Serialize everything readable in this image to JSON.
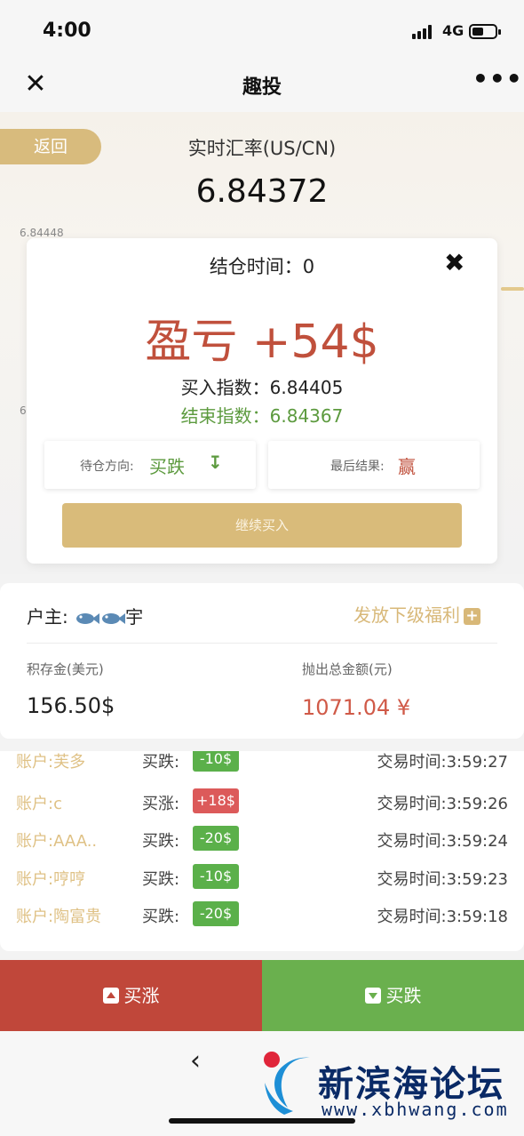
{
  "status": {
    "time": "4:00",
    "network": "4G"
  },
  "nav": {
    "title": "趣投"
  },
  "hero": {
    "back_label": "返回",
    "rate_label": "实时汇率(US/CN)",
    "rate_value": "6.84372",
    "axis_top": "6.84448",
    "axis_mid": "6"
  },
  "modal": {
    "title": "结仓时间：0",
    "pnl": "盈亏 +54$",
    "buy_index": "买入指数：6.84405",
    "end_index": "结束指数：6.84367",
    "direction_label": "待仓方向:",
    "direction_value": "买跌",
    "result_label": "最后结果:",
    "result_value": "赢",
    "continue_label": "继续买入"
  },
  "account": {
    "owner_label": "户主:",
    "owner_name": "宇",
    "welfare_label": "发放下级福利",
    "deposit_label": "积存金(美元)",
    "deposit_value": "156.50$",
    "withdraw_label": "抛出总金额(元)",
    "withdraw_value": "1071.04 ¥"
  },
  "trades": [
    {
      "account": "账户:芙多",
      "type": "买跌:",
      "amount": "-10$",
      "time": "交易时间:3:59:27",
      "color": "#5bb04a"
    },
    {
      "account": "账户:c",
      "type": "买涨:",
      "amount": "+18$",
      "time": "交易时间:3:59:26",
      "color": "#dc5a5a"
    },
    {
      "account": "账户:AAA..",
      "type": "买跌:",
      "amount": "-20$",
      "time": "交易时间:3:59:24",
      "color": "#5bb04a"
    },
    {
      "account": "账户:哼哼",
      "type": "买跌:",
      "amount": "-10$",
      "time": "交易时间:3:59:23",
      "color": "#5bb04a"
    },
    {
      "account": "账户:陶富贵",
      "type": "买跌:",
      "amount": "-20$",
      "time": "交易时间:3:59:18",
      "color": "#5bb04a"
    }
  ],
  "actions": {
    "buy_up": "买涨",
    "buy_down": "买跌"
  },
  "watermark": {
    "title": "新滨海论坛",
    "url": "www.xbhwang.com"
  },
  "colors": {
    "gold": "#d8bb7d",
    "red": "#c0473a",
    "green": "#6ab04e"
  }
}
